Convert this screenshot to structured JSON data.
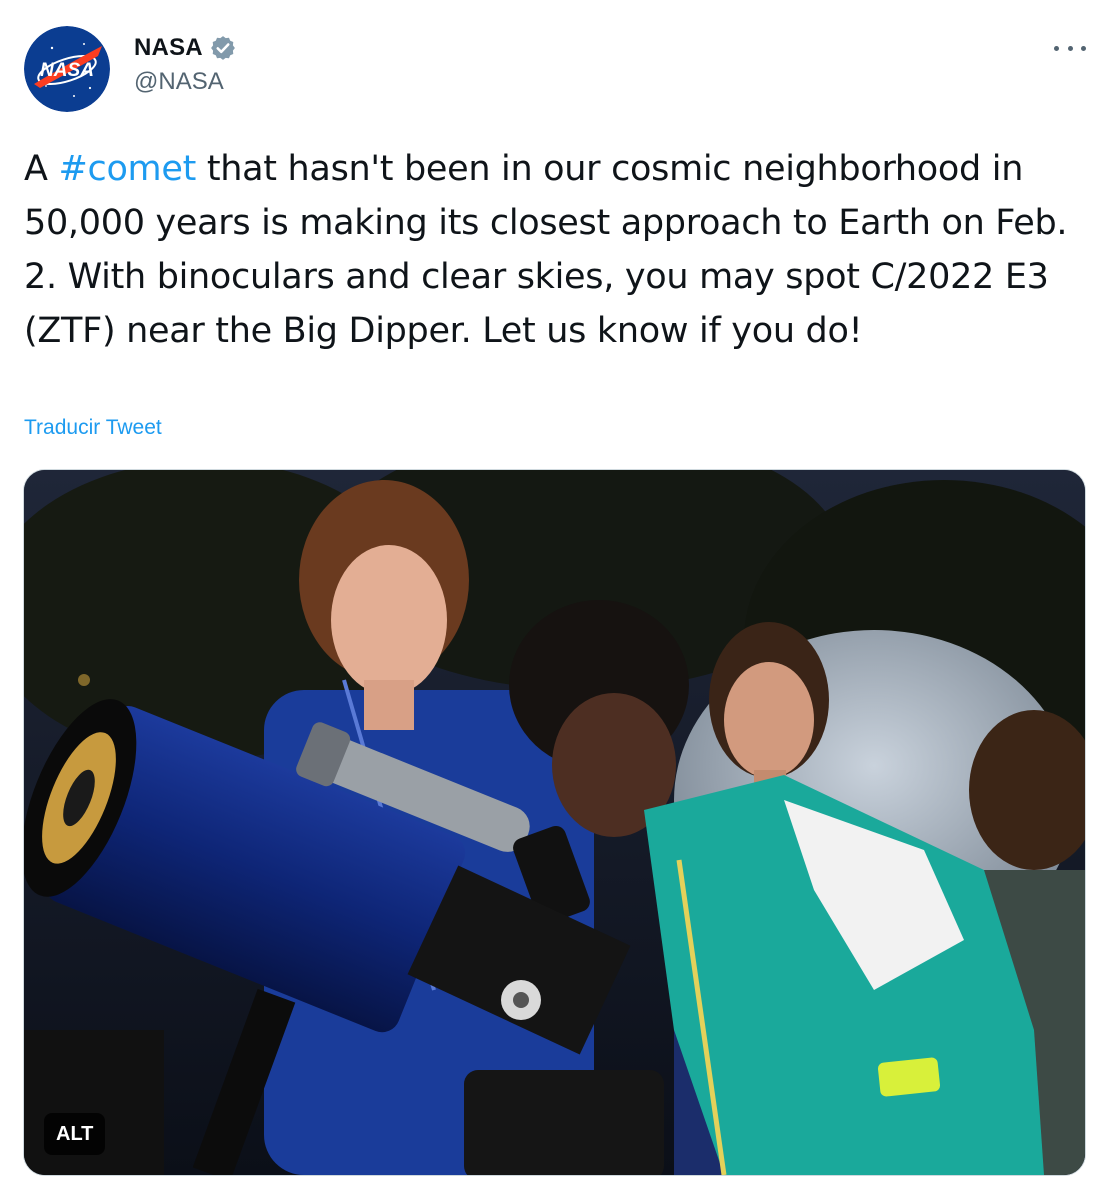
{
  "account": {
    "display_name": "NASA",
    "handle": "@NASA",
    "avatar_logo_text": "NASA",
    "verified_icon": "verified-badge-icon",
    "brand_color": "#0b3d91"
  },
  "menu": {
    "more_icon": "more-options-icon"
  },
  "tweet": {
    "text_before": "A ",
    "hashtag": "#comet",
    "text_after": " that hasn't been in our cosmic neighborhood in 50,000 years is making its closest approach to Earth on Feb. 2. With binoculars and clear skies, you may spot C/2022 E3 (ZTF) near the Big Dipper. Let us know if you do!",
    "translate_label": "Traducir Tweet",
    "link_color": "#1d9bf0"
  },
  "media": {
    "alt_label": "ALT"
  }
}
